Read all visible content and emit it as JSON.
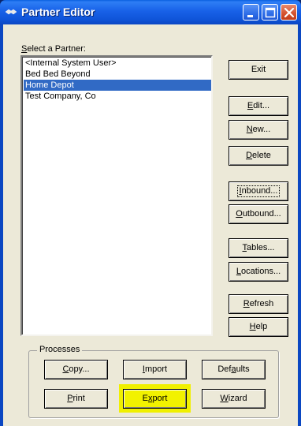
{
  "window": {
    "title": "Partner Editor",
    "icons": [
      "app-icon",
      "minimize-icon",
      "maximize-icon",
      "close-icon"
    ]
  },
  "partner_list": {
    "label_accel": "S",
    "label_rest": "elect a Partner:",
    "items": [
      {
        "label": "<Internal System User>",
        "selected": false
      },
      {
        "label": "Bed Bed Beyond",
        "selected": false
      },
      {
        "label": "Home Depot",
        "selected": true
      },
      {
        "label": "Test Company, Co",
        "selected": false
      }
    ]
  },
  "side_buttons": {
    "exit": {
      "accel": "",
      "rest": "Exit"
    },
    "edit": {
      "accel": "E",
      "rest": "dit..."
    },
    "new": {
      "accel": "N",
      "rest": "ew..."
    },
    "delete": {
      "accel": "D",
      "rest": "elete"
    },
    "inbound": {
      "accel": "I",
      "rest": "nbound..."
    },
    "outbound": {
      "accel": "O",
      "rest": "utbound..."
    },
    "tables": {
      "accel": "T",
      "rest": "ables..."
    },
    "locations": {
      "accel": "L",
      "rest": "ocations..."
    },
    "refresh": {
      "accel": "R",
      "rest": "efresh"
    },
    "help": {
      "accel": "H",
      "rest": "elp"
    }
  },
  "processes": {
    "title": "Processes",
    "copy": {
      "accel": "C",
      "rest": "opy..."
    },
    "import": {
      "accel": "I",
      "rest": "mport"
    },
    "defaults": {
      "pre": "Def",
      "accel": "a",
      "rest": "ults"
    },
    "print": {
      "accel": "P",
      "rest": "rint"
    },
    "export": {
      "pre": "E",
      "accel": "x",
      "rest": "port"
    },
    "wizard": {
      "accel": "W",
      "rest": "izard"
    }
  },
  "colors": {
    "titlebar": "#0b47c2",
    "selection": "#316ac5",
    "dialog_face": "#ece9d8",
    "highlight": "#f0f000",
    "close_button": "#d5522f"
  }
}
